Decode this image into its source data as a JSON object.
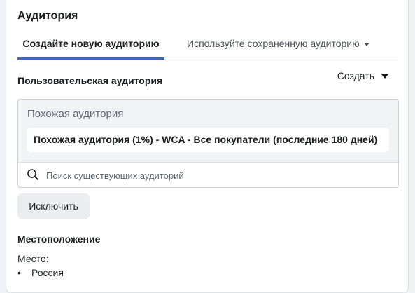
{
  "panel": {
    "title": "Аудитория"
  },
  "tabs": [
    {
      "label": "Создайте новую аудиторию",
      "active": true
    },
    {
      "label": "Используйте сохраненную аудиторию",
      "active": false,
      "icon": "caret-down-icon"
    }
  ],
  "custom_audience": {
    "label": "Пользовательская аудитория",
    "create_dropdown": {
      "label": "Создать",
      "icon": "caret-down-icon"
    },
    "group_label": "Похожая аудитория",
    "selected": [
      "Похожая аудитория (1%) - WCA - Все покупатели (последние 180 дней)"
    ],
    "search": {
      "placeholder": "Поиск существующих аудиторий",
      "value": "",
      "icon": "search-icon"
    },
    "exclude_button": "Исключить"
  },
  "location": {
    "heading": "Местоположение",
    "sub_label": "Место:",
    "items": [
      "Россия"
    ]
  },
  "colors": {
    "accent": "#4267b2",
    "background": "#f0f2f5",
    "card": "#ffffff",
    "muted_text": "#606770"
  }
}
